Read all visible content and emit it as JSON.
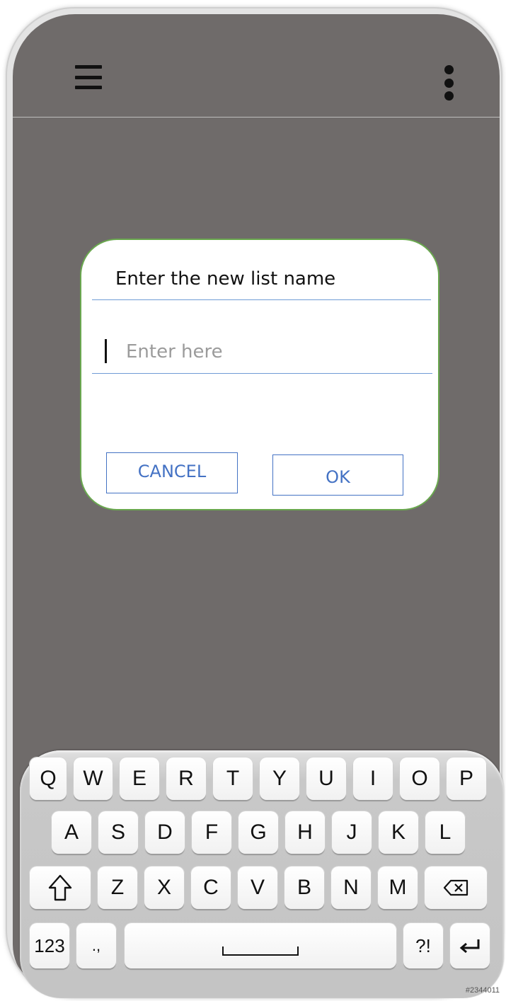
{
  "dialog": {
    "title": "Enter the new list name",
    "input_placeholder": "Enter here",
    "input_value": "",
    "cancel_label": "CANCEL",
    "ok_label": "OK"
  },
  "keyboard": {
    "row1": [
      "Q",
      "W",
      "E",
      "R",
      "T",
      "Y",
      "U",
      "I",
      "O",
      "P"
    ],
    "row2": [
      "A",
      "S",
      "D",
      "F",
      "G",
      "H",
      "J",
      "K",
      "L"
    ],
    "row3": [
      "Z",
      "X",
      "C",
      "V",
      "B",
      "N",
      "M"
    ],
    "shift_icon": "shift-arrow-icon",
    "backspace_icon": "backspace-icon",
    "numbers_label": "123",
    "punct_label": ".,",
    "space_icon": "space-bar-icon",
    "symbols_label": "?!",
    "enter_icon": "enter-arrow-icon"
  },
  "watermark": "#2344011",
  "colors": {
    "screen_bg": "#6f6b6a",
    "dialog_border": "#6aa84f",
    "accent_blue": "#4472c4",
    "divider_blue": "#6f9bd6"
  }
}
